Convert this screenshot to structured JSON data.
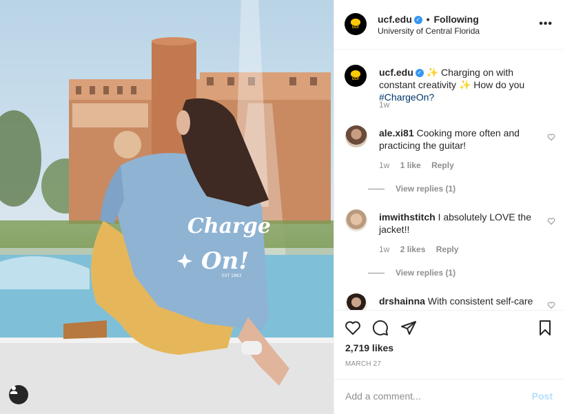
{
  "photo": {
    "jacket_text_line1": "Charge",
    "jacket_text_line2": "On!",
    "jacket_small_text": "EST 1963"
  },
  "header": {
    "username": "ucf.edu",
    "separator": "•",
    "following_label": "Following",
    "location": "University of Central Florida",
    "more_label": "•••",
    "avatar_text": "UCF"
  },
  "caption": {
    "username": "ucf.edu",
    "text_before": "Charging on with constant creativity",
    "text_after": "How do you",
    "hashtag": "#ChargeOn?",
    "age": "1w"
  },
  "comments": [
    {
      "username": "ale.xi81",
      "text": "Cooking more often and practicing the guitar!",
      "age": "1w",
      "likes": "1 like",
      "reply_label": "Reply",
      "view_replies": "View replies (1)"
    },
    {
      "username": "imwithstitch",
      "text": "I absolutely LOVE the jacket!!",
      "age": "1w",
      "likes": "2 likes",
      "reply_label": "Reply",
      "view_replies": "View replies (1)"
    },
    {
      "username": "drshainna",
      "text": "With consistent self-care"
    }
  ],
  "actions": {
    "likes": "2,719 likes",
    "date": "MARCH 27"
  },
  "add_comment": {
    "placeholder": "Add a comment...",
    "post_label": "Post"
  },
  "colors": {
    "verified": "#3897f0",
    "hashtag": "#00376b",
    "post_disabled": "#b2dffc",
    "ucf_gold": "#ffc904"
  }
}
